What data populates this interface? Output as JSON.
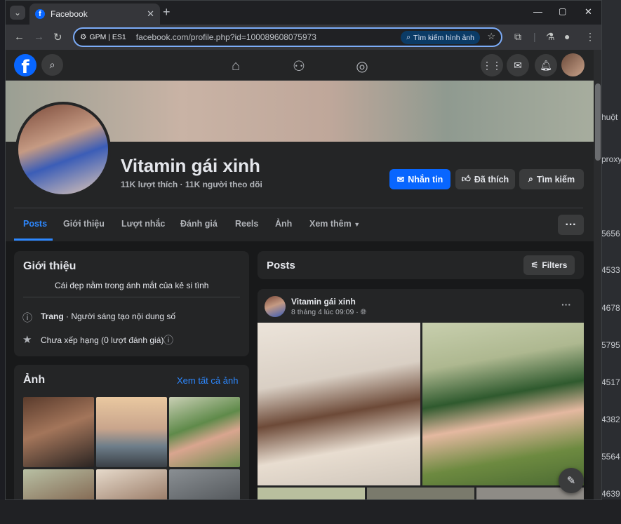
{
  "browser": {
    "tab_title": "Facebook",
    "url": "facebook.com/profile.php?id=100089608075973",
    "site_label": "GPM | ES1",
    "lens_label": "Tìm kiếm hình ảnh"
  },
  "background_app": {
    "side_texts": [
      "huột",
      "proxy",
      "5656",
      "4533",
      "4678",
      "5795",
      "4517",
      "4382",
      "5564",
      "4639"
    ]
  },
  "profile": {
    "name": "Vitamin gái xinh",
    "stats": "11K lượt thích · 11K người theo dõi",
    "buttons": {
      "message": "Nhắn tin",
      "liked": "Đã thích",
      "search": "Tìm kiếm"
    }
  },
  "profile_tabs": [
    "Posts",
    "Giới thiệu",
    "Lượt nhắc",
    "Đánh giá",
    "Reels",
    "Ảnh",
    "Xem thêm"
  ],
  "intro": {
    "title": "Giới thiệu",
    "bio": "Cái đẹp nằm trong ánh mắt của kẻ si tình",
    "category_bold": "Trang",
    "category_rest": " · Người sáng tạo nội dung số",
    "rating": "Chưa xếp hạng (0 lượt đánh giá)"
  },
  "photos": {
    "title": "Ảnh",
    "see_all": "Xem tất cả ảnh"
  },
  "posts_header": {
    "title": "Posts",
    "filters": "Filters"
  },
  "post": {
    "author": "Vitamin gái xinh",
    "time": "8 tháng 4 lúc 09:09 ·"
  },
  "colors": {
    "facebook_blue": "#0866ff",
    "link_blue": "#2d88ff",
    "surface": "#242526",
    "background": "#18191a"
  }
}
